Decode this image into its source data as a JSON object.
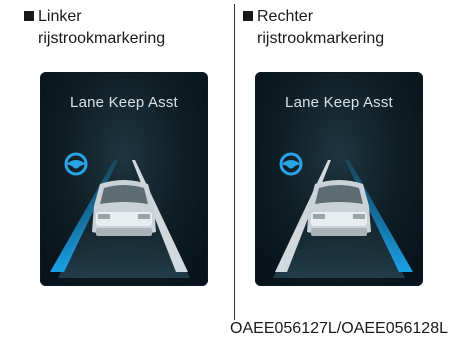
{
  "left_panel": {
    "caption_line1": "Linker",
    "caption_line2": "rijstrookmarkering",
    "screen_title": "Lane Keep Asst",
    "highlighted_lane": "left"
  },
  "right_panel": {
    "caption_line1": "Rechter",
    "caption_line2": "rijstrookmarkering",
    "screen_title": "Lane Keep Asst",
    "highlighted_lane": "right"
  },
  "figure_code": "OAEE056127L/OAEE056128L",
  "colors": {
    "lane_highlight": "#1aa0e6",
    "lane_normal": "#dfe6ea",
    "icon": "#2aa3e6"
  },
  "icons": [
    "steering-wheel-icon",
    "car-rear-icon"
  ]
}
